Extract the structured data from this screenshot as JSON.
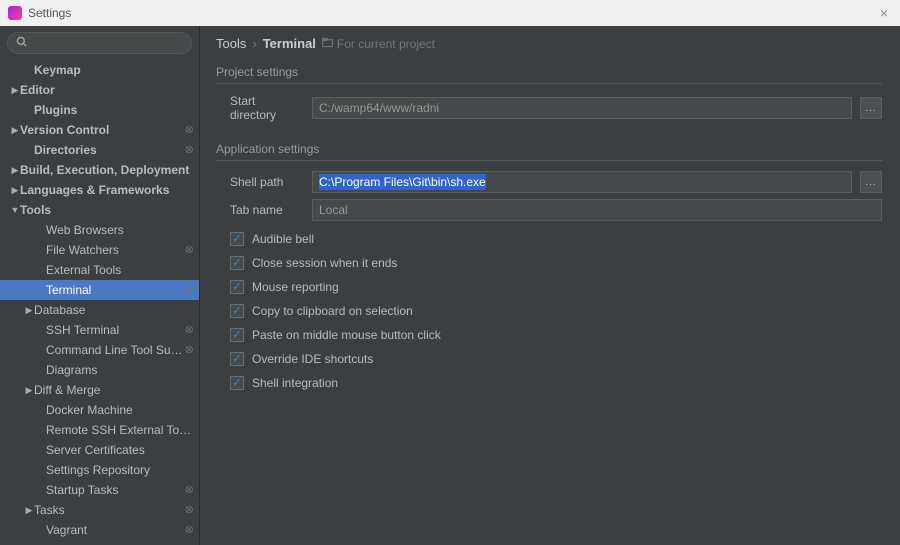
{
  "window": {
    "title": "Settings",
    "close": "×"
  },
  "search": {
    "placeholder": ""
  },
  "sidebar": {
    "items": [
      {
        "label": "Keymap",
        "level": 1,
        "arrow": "",
        "bold": true
      },
      {
        "label": "Editor",
        "level": 0,
        "arrow": "▶",
        "bold": true
      },
      {
        "label": "Plugins",
        "level": 1,
        "arrow": "",
        "bold": true
      },
      {
        "label": "Version Control",
        "level": 0,
        "arrow": "▶",
        "bold": true,
        "link": true
      },
      {
        "label": "Directories",
        "level": 1,
        "arrow": "",
        "bold": true,
        "link": true
      },
      {
        "label": "Build, Execution, Deployment",
        "level": 0,
        "arrow": "▶",
        "bold": true
      },
      {
        "label": "Languages & Frameworks",
        "level": 0,
        "arrow": "▶",
        "bold": true
      },
      {
        "label": "Tools",
        "level": 0,
        "arrow": "▼",
        "bold": true
      },
      {
        "label": "Web Browsers",
        "level": 2,
        "arrow": ""
      },
      {
        "label": "File Watchers",
        "level": 2,
        "arrow": "",
        "link": true
      },
      {
        "label": "External Tools",
        "level": 2,
        "arrow": ""
      },
      {
        "label": "Terminal",
        "level": 2,
        "arrow": "",
        "selected": true,
        "link": true
      },
      {
        "label": "Database",
        "level": 1,
        "arrow": "▶"
      },
      {
        "label": "SSH Terminal",
        "level": 2,
        "arrow": "",
        "link": true
      },
      {
        "label": "Command Line Tool Support",
        "level": 2,
        "arrow": "",
        "link": true
      },
      {
        "label": "Diagrams",
        "level": 2,
        "arrow": ""
      },
      {
        "label": "Diff & Merge",
        "level": 1,
        "arrow": "▶"
      },
      {
        "label": "Docker Machine",
        "level": 2,
        "arrow": ""
      },
      {
        "label": "Remote SSH External Tools",
        "level": 2,
        "arrow": ""
      },
      {
        "label": "Server Certificates",
        "level": 2,
        "arrow": ""
      },
      {
        "label": "Settings Repository",
        "level": 2,
        "arrow": ""
      },
      {
        "label": "Startup Tasks",
        "level": 2,
        "arrow": "",
        "link": true
      },
      {
        "label": "Tasks",
        "level": 1,
        "arrow": "▶",
        "link": true
      },
      {
        "label": "Vagrant",
        "level": 2,
        "arrow": "",
        "link": true
      }
    ]
  },
  "breadcrumb": {
    "part1": "Tools",
    "sep": "›",
    "part2": "Terminal",
    "proj_label": "For current project"
  },
  "sections": {
    "project": "Project settings",
    "application": "Application settings"
  },
  "fields": {
    "start_dir": {
      "label": "Start directory",
      "value": "C:/wamp64/www/radni"
    },
    "shell_path": {
      "label": "Shell path",
      "value": "C:\\Program Files\\Git\\bin\\sh.exe"
    },
    "tab_name": {
      "label": "Tab name",
      "value": "Local"
    }
  },
  "browse": "...",
  "checks": [
    {
      "label": "Audible bell",
      "checked": true
    },
    {
      "label": "Close session when it ends",
      "checked": true
    },
    {
      "label": "Mouse reporting",
      "checked": true
    },
    {
      "label": "Copy to clipboard on selection",
      "checked": true
    },
    {
      "label": "Paste on middle mouse button click",
      "checked": true
    },
    {
      "label": "Override IDE shortcuts",
      "checked": true
    },
    {
      "label": "Shell integration",
      "checked": true
    }
  ],
  "icons": {
    "link": "⭙"
  }
}
